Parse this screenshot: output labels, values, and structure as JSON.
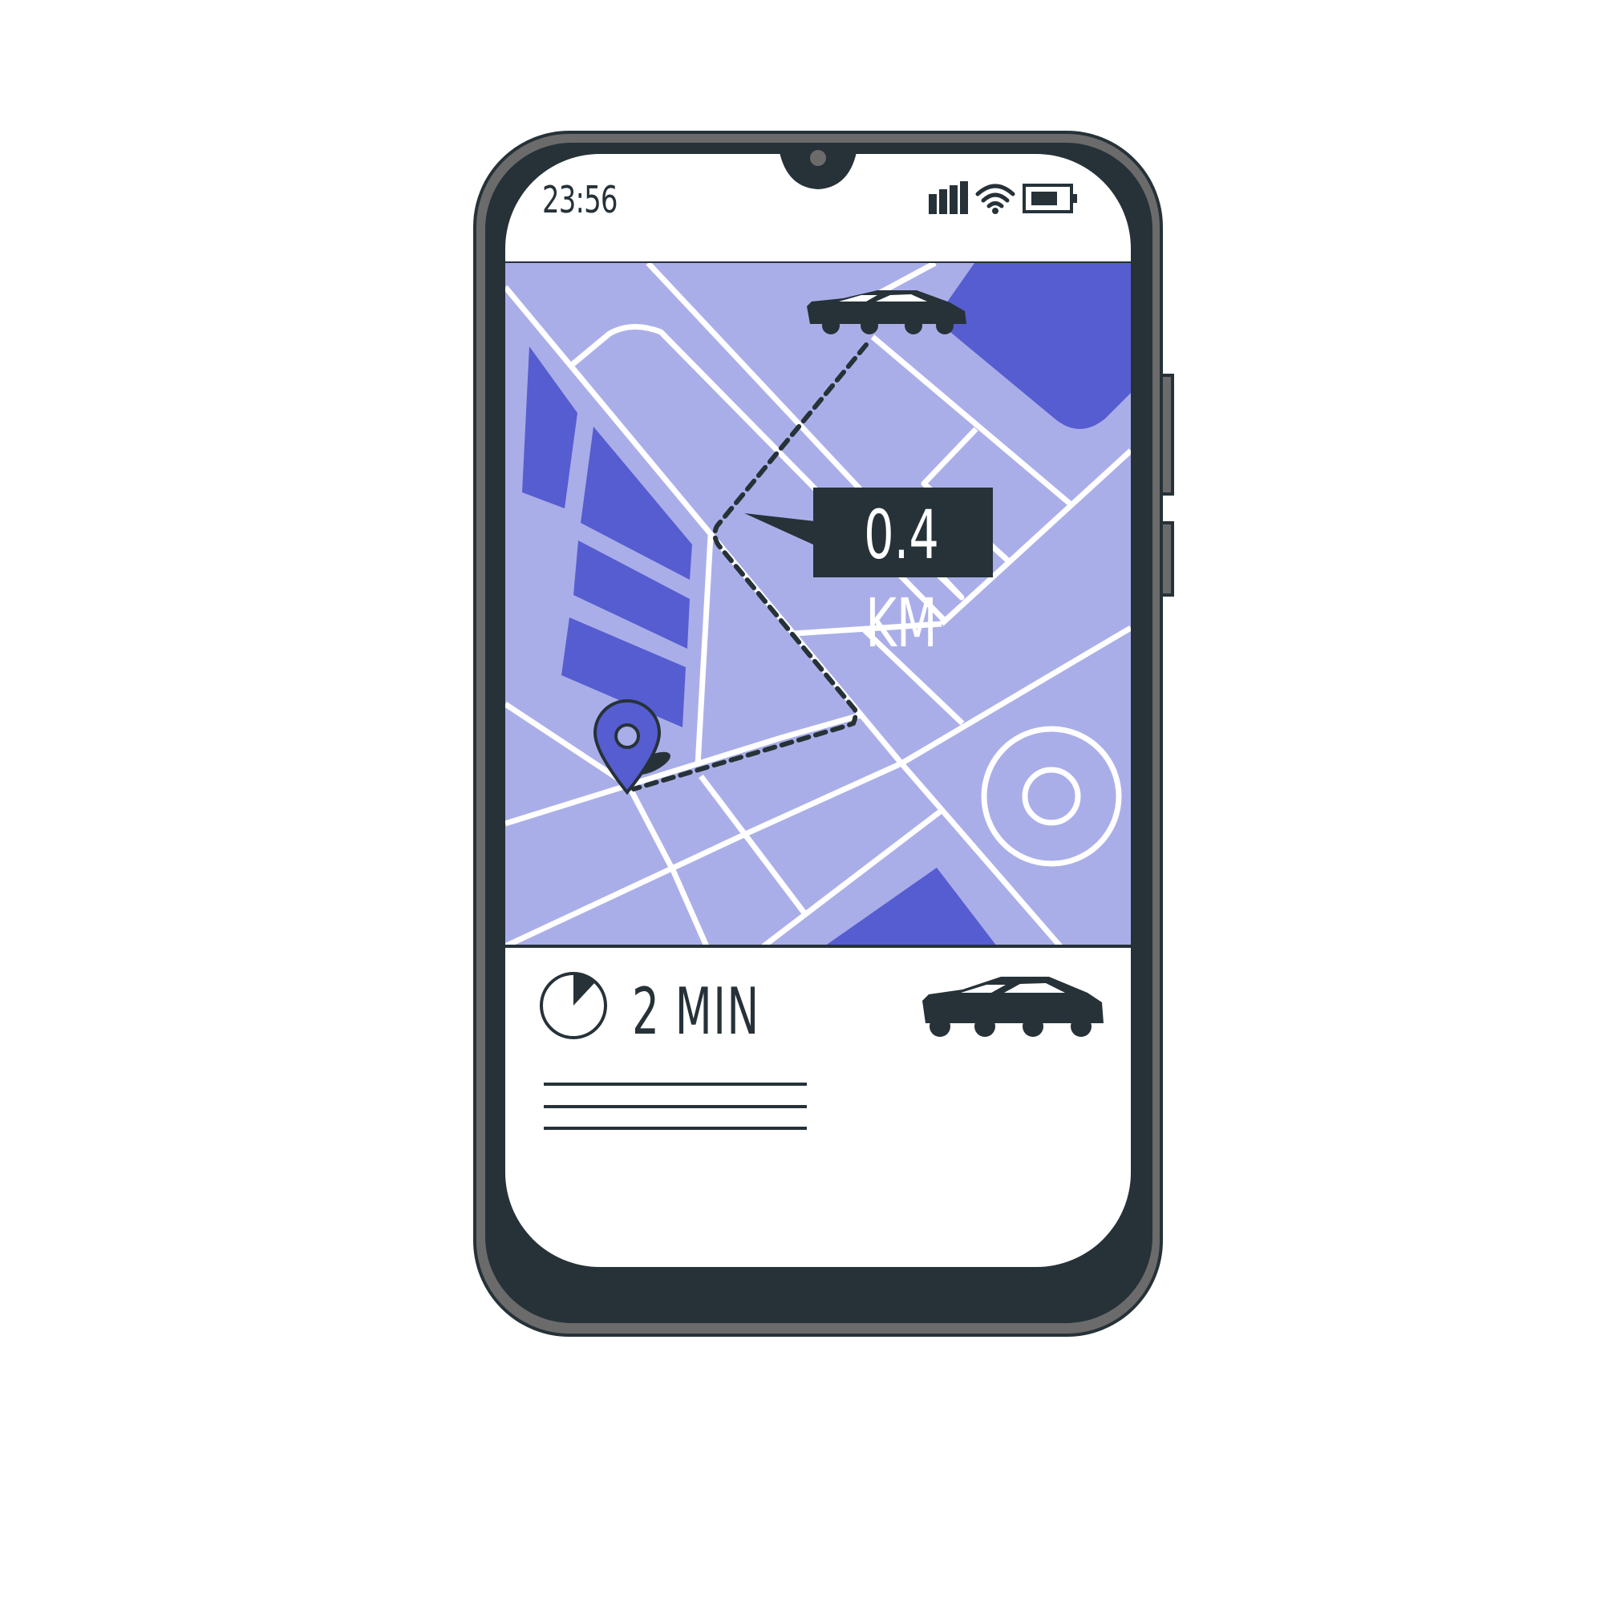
{
  "status_bar": {
    "time": "23:56",
    "signal_icon": "signal-bars-icon",
    "wifi_icon": "wifi-icon",
    "battery_icon": "battery-icon"
  },
  "map": {
    "distance_label": "0.4 KM",
    "car_icon": "car-icon",
    "destination_icon": "location-pin-icon",
    "landmark_icon": "roundabout-icon"
  },
  "trip_panel": {
    "eta": "2 MIN",
    "clock_icon": "clock-icon",
    "car_icon": "car-icon"
  },
  "colors": {
    "map_background": "#aaaee8",
    "map_blocks": "#565dd1",
    "roads": "#ffffff",
    "device_frame": "#263238",
    "device_edge": "#6b6b6b",
    "screen": "#ffffff"
  }
}
